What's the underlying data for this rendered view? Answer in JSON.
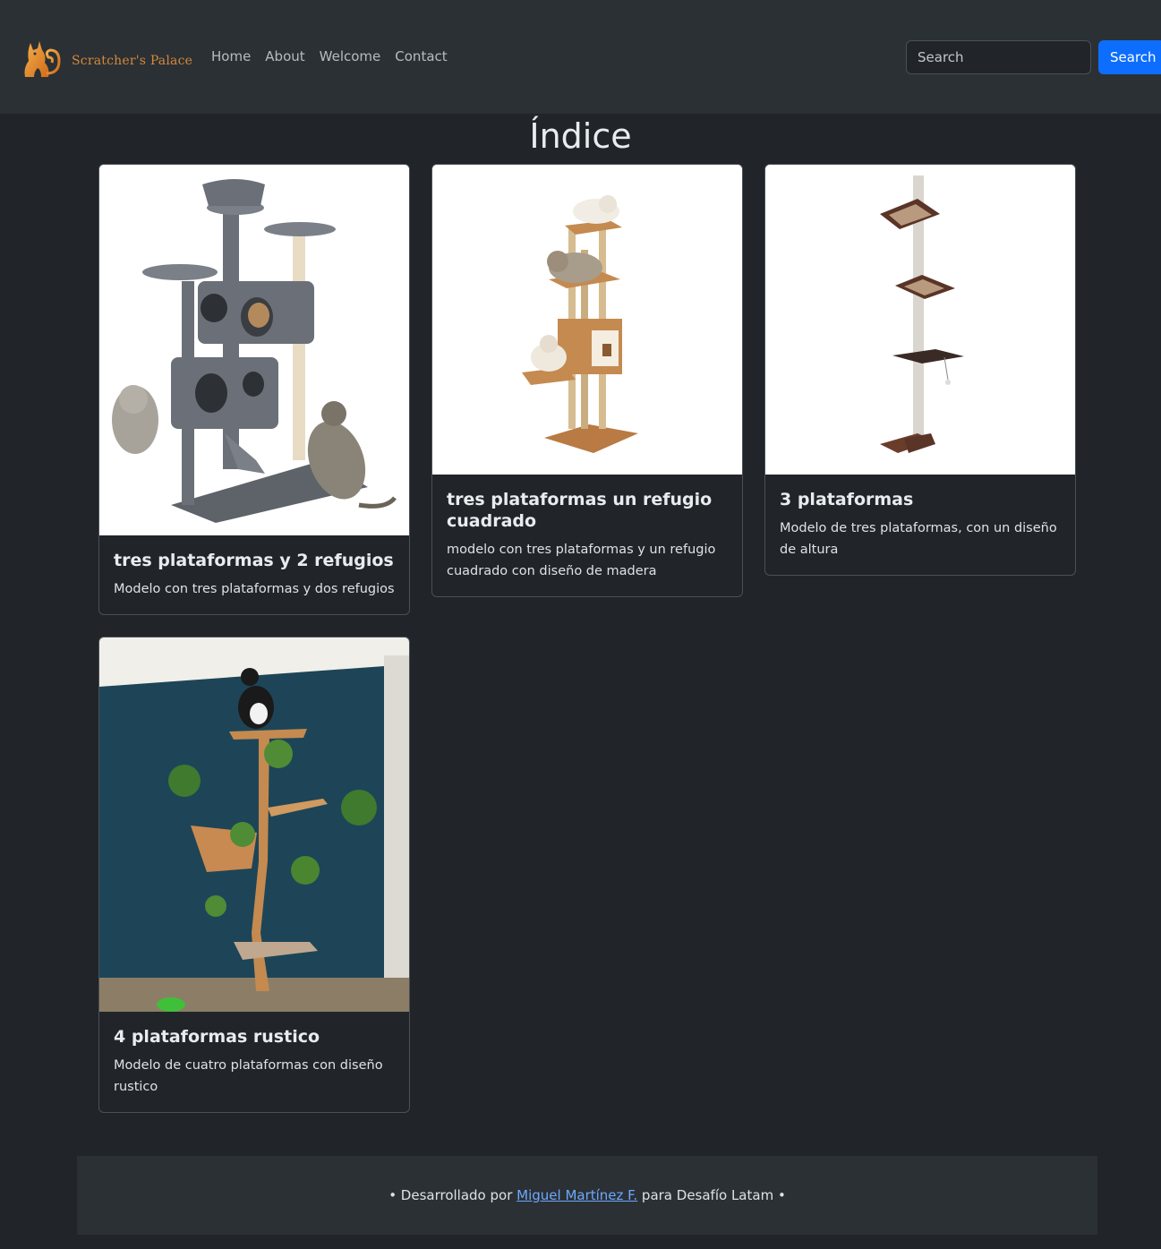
{
  "navbar": {
    "brand": "Scratcher's Palace",
    "links": [
      "Home",
      "About",
      "Welcome",
      "Contact"
    ],
    "search_placeholder": "Search",
    "search_button": "Search"
  },
  "main": {
    "title": "Índice",
    "cards": [
      {
        "title": "tres plataformas y 2 refugios",
        "text": "Modelo con tres plataformas y dos refugios",
        "image": "gray-cat-tree-with-cats"
      },
      {
        "title": "tres plataformas un refugio cuadrado",
        "text": "modelo con tres plataformas y un refugio cuadrado con diseño de madera",
        "image": "wooden-cat-tree-with-cats"
      },
      {
        "title": "3 plataformas",
        "text": "Modelo de tres plataformas, con un diseño de altura",
        "image": "tall-pole-cat-tree"
      },
      {
        "title": "4 plataformas rustico",
        "text": "Modelo de cuatro plataformas con diseño rustico",
        "image": "rustic-branch-cat-tree"
      }
    ]
  },
  "footer": {
    "prefix": "• Desarrollado por ",
    "author": "Miguel Martínez F.",
    "suffix": " para Desafío Latam •"
  },
  "colors": {
    "background": "#212529",
    "navbar": "#2b3035",
    "accent": "#0d6efd",
    "brand": "#d4893a",
    "link": "#6ea8fe"
  }
}
